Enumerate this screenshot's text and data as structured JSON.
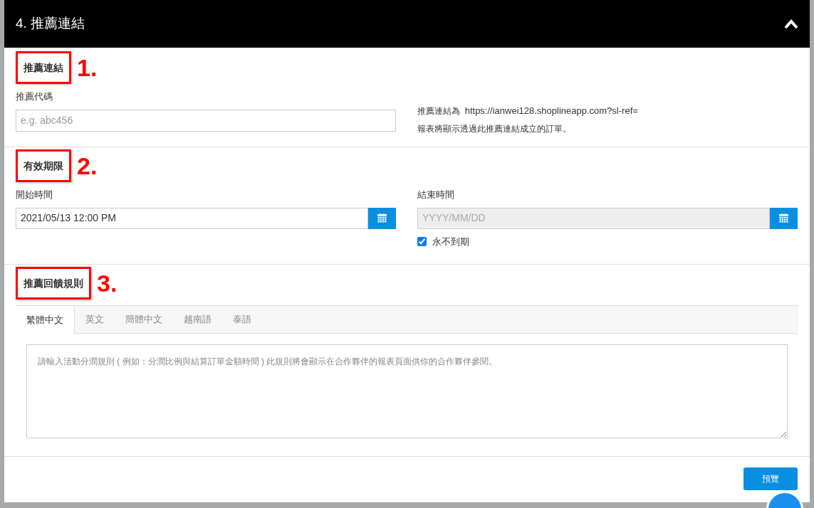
{
  "panel": {
    "title": "4. 推薦連結",
    "expanded": true
  },
  "referral_link": {
    "heading": "推薦連結",
    "annotation": "1.",
    "code_label": "推薦代碼",
    "code_placeholder": "e.g. abc456",
    "link_prefix": "推薦連結為",
    "link_url": "https://ianwei128.shoplineapp.com?sl-ref=",
    "link_note": "報表將顯示透過此推薦連結成立的訂單。"
  },
  "validity": {
    "heading": "有效期限",
    "annotation": "2.",
    "start_label": "開始時間",
    "start_value": "2021/05/13 12:00 PM",
    "end_label": "結束時間",
    "end_placeholder": "YYYY/MM/DD",
    "end_disabled": true,
    "never_expires": {
      "label": "永不到期",
      "checked": true
    }
  },
  "rules": {
    "heading": "推薦回饋規則",
    "annotation": "3.",
    "tabs": [
      {
        "label": "繁體中文",
        "selected": true
      },
      {
        "label": "英文",
        "selected": false
      },
      {
        "label": "簡體中文",
        "selected": false
      },
      {
        "label": "越南語",
        "selected": false
      },
      {
        "label": "泰語",
        "selected": false
      }
    ],
    "placeholder": "請輸入活動分潤規則 ( 例如：分潤比例與結算訂單金額時間 ) 此規則將會顯示在合作夥伴的報表頁面供你的合作夥伴參閱。"
  },
  "footer": {
    "preview_button": "預覽"
  }
}
